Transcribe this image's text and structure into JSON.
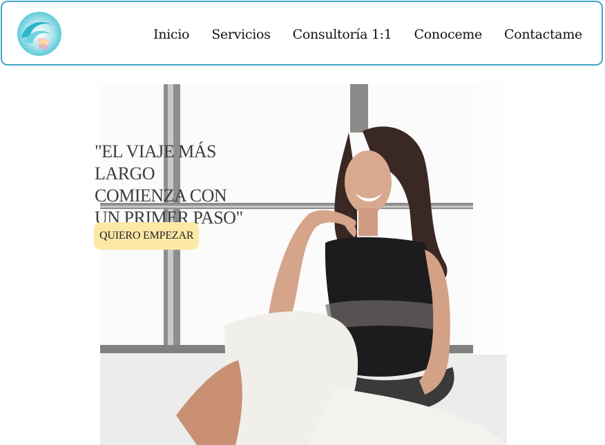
{
  "header": {
    "logo_icon": "wave-sun-logo",
    "accent_color": "#3ea6c4",
    "nav": [
      {
        "label": "Inicio"
      },
      {
        "label": "Servicios"
      },
      {
        "label": "Consultoría 1:1"
      },
      {
        "label": "Conoceme"
      },
      {
        "label": "Contactame"
      }
    ]
  },
  "hero": {
    "quote": "\"EL VIAJE MÁS LARGO\nCOMIENZA CON\nUN PRIMER PASO\"",
    "cta_label": "QUIERO EMPEZAR",
    "cta_color": "#fde9a6",
    "image": "smiling-woman-by-window-photo"
  }
}
